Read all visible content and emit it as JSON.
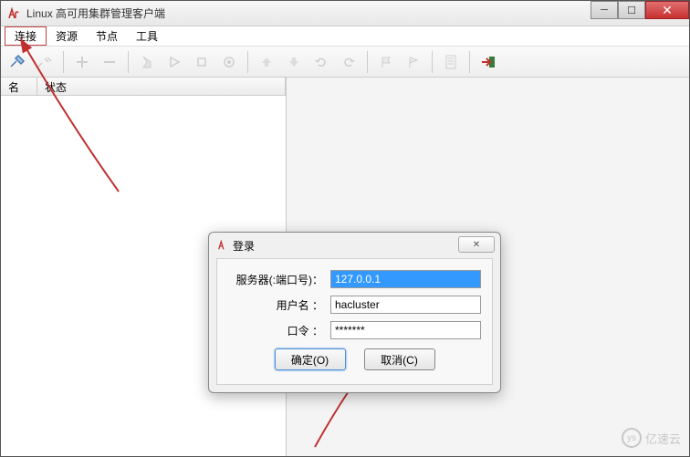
{
  "window": {
    "title": "Linux 高可用集群管理客户端"
  },
  "menu": {
    "connect": "连接",
    "resource": "资源",
    "node": "节点",
    "tool": "工具"
  },
  "list_headers": {
    "name": "名称",
    "status": "状态"
  },
  "dialog": {
    "title": "登录",
    "server_label": "服务器(:端口号)：",
    "server_value": "127.0.0.1",
    "user_label": "用户名 ：",
    "user_value": "hacluster",
    "pass_label": "口令 ：",
    "pass_value": "*******",
    "ok_label": "确定(O)",
    "cancel_label": "取消(C)"
  },
  "watermark": "亿速云"
}
